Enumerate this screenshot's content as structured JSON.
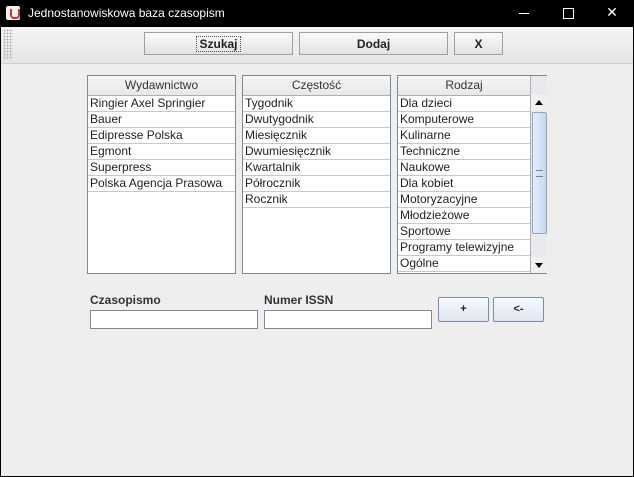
{
  "window": {
    "title": "Jednostanowiskowa baza czasopism"
  },
  "toolbar": {
    "search_label": "Szukaj",
    "add_label": "Dodaj",
    "close_label": "X"
  },
  "lists": {
    "wydawnictwo": {
      "header": "Wydawnictwo",
      "items": [
        "Ringier Axel Springier",
        "Bauer",
        "Edipresse Polska",
        "Egmont",
        "Superpress",
        "Polska Agencja Prasowa"
      ]
    },
    "czestosc": {
      "header": "Częstość",
      "items": [
        "Tygodnik",
        "Dwutygodnik",
        "Miesięcznik",
        "Dwumiesięcznik",
        "Kwartalnik",
        "Półrocznik",
        "Rocznik"
      ]
    },
    "rodzaj": {
      "header": "Rodzaj",
      "items": [
        "Dla dzieci",
        "Komputerowe",
        "Kulinarne",
        "Techniczne",
        "Naukowe",
        "Dla kobiet",
        "Motoryzacyjne",
        "Młodzieżowe",
        "Sportowe",
        "Programy telewizyjne",
        "Ogólne"
      ]
    }
  },
  "form": {
    "czasopismo_label": "Czasopismo",
    "czasopismo_value": "",
    "issn_label": "Numer ISSN",
    "issn_value": "",
    "plus_label": "+",
    "back_label": "<-"
  }
}
